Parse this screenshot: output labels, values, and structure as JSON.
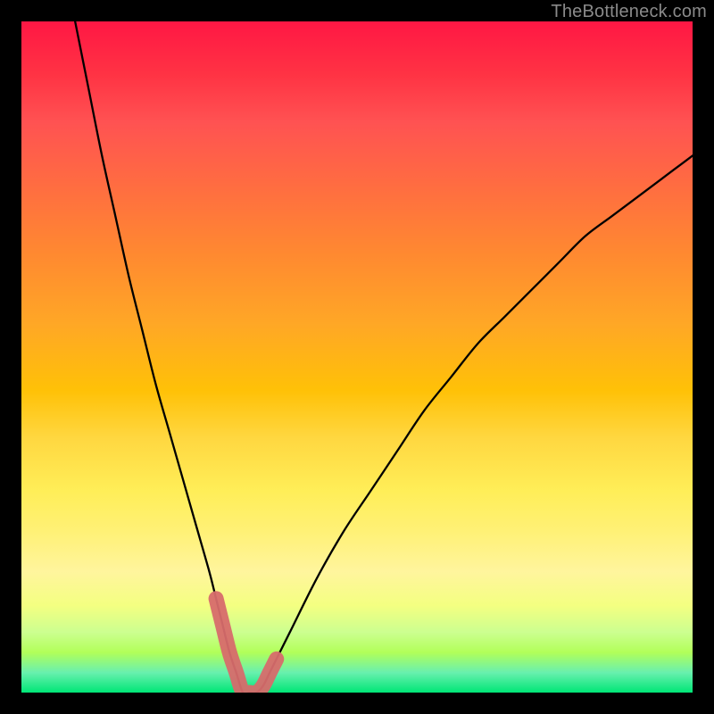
{
  "watermark": "TheBottleneck.com",
  "chart_data": {
    "type": "line",
    "title": "",
    "xlabel": "",
    "ylabel": "",
    "xlim": [
      0,
      100
    ],
    "ylim": [
      0,
      100
    ],
    "grid": false,
    "legend": false,
    "annotations": [],
    "note": "Background gradient indicates bottleneck severity: green (0%, bottom) to red (100%, top). Curve is a V-shaped bottleneck profile with minimum near x≈33 touching 0.",
    "series": [
      {
        "name": "bottleneck-curve",
        "color": "#000000",
        "x": [
          8,
          10,
          12,
          14,
          16,
          18,
          20,
          22,
          24,
          26,
          28,
          29,
          30,
          31,
          32,
          33,
          34,
          35,
          36,
          37,
          38,
          40,
          44,
          48,
          52,
          56,
          60,
          64,
          68,
          72,
          76,
          80,
          84,
          88,
          92,
          96,
          100
        ],
        "y": [
          100,
          90,
          80,
          71,
          62,
          54,
          46,
          39,
          32,
          25,
          18,
          14,
          10,
          6,
          3,
          0,
          0,
          0,
          1,
          3,
          5,
          9,
          17,
          24,
          30,
          36,
          42,
          47,
          52,
          56,
          60,
          64,
          68,
          71,
          74,
          77,
          80
        ]
      },
      {
        "name": "highlight-band",
        "color": "#d76b6b",
        "x": [
          29,
          30,
          31,
          32,
          33,
          34,
          35,
          36,
          37,
          38
        ],
        "y": [
          14,
          10,
          6,
          3,
          0,
          0,
          0,
          1,
          3,
          5
        ]
      }
    ],
    "gradient_stops": [
      {
        "pos": 0.0,
        "color": "#ff1744"
      },
      {
        "pos": 0.08,
        "color": "#ff3344"
      },
      {
        "pos": 0.15,
        "color": "#ff5252"
      },
      {
        "pos": 0.25,
        "color": "#ff6e40"
      },
      {
        "pos": 0.35,
        "color": "#ff8a30"
      },
      {
        "pos": 0.45,
        "color": "#ffa726"
      },
      {
        "pos": 0.55,
        "color": "#ffc107"
      },
      {
        "pos": 0.62,
        "color": "#ffd740"
      },
      {
        "pos": 0.7,
        "color": "#ffee58"
      },
      {
        "pos": 0.76,
        "color": "#fff176"
      },
      {
        "pos": 0.82,
        "color": "#fff59d"
      },
      {
        "pos": 0.87,
        "color": "#f4ff81"
      },
      {
        "pos": 0.91,
        "color": "#ccff90"
      },
      {
        "pos": 0.94,
        "color": "#b2ff59"
      },
      {
        "pos": 0.97,
        "color": "#69f0ae"
      },
      {
        "pos": 1.0,
        "color": "#00e676"
      }
    ]
  }
}
